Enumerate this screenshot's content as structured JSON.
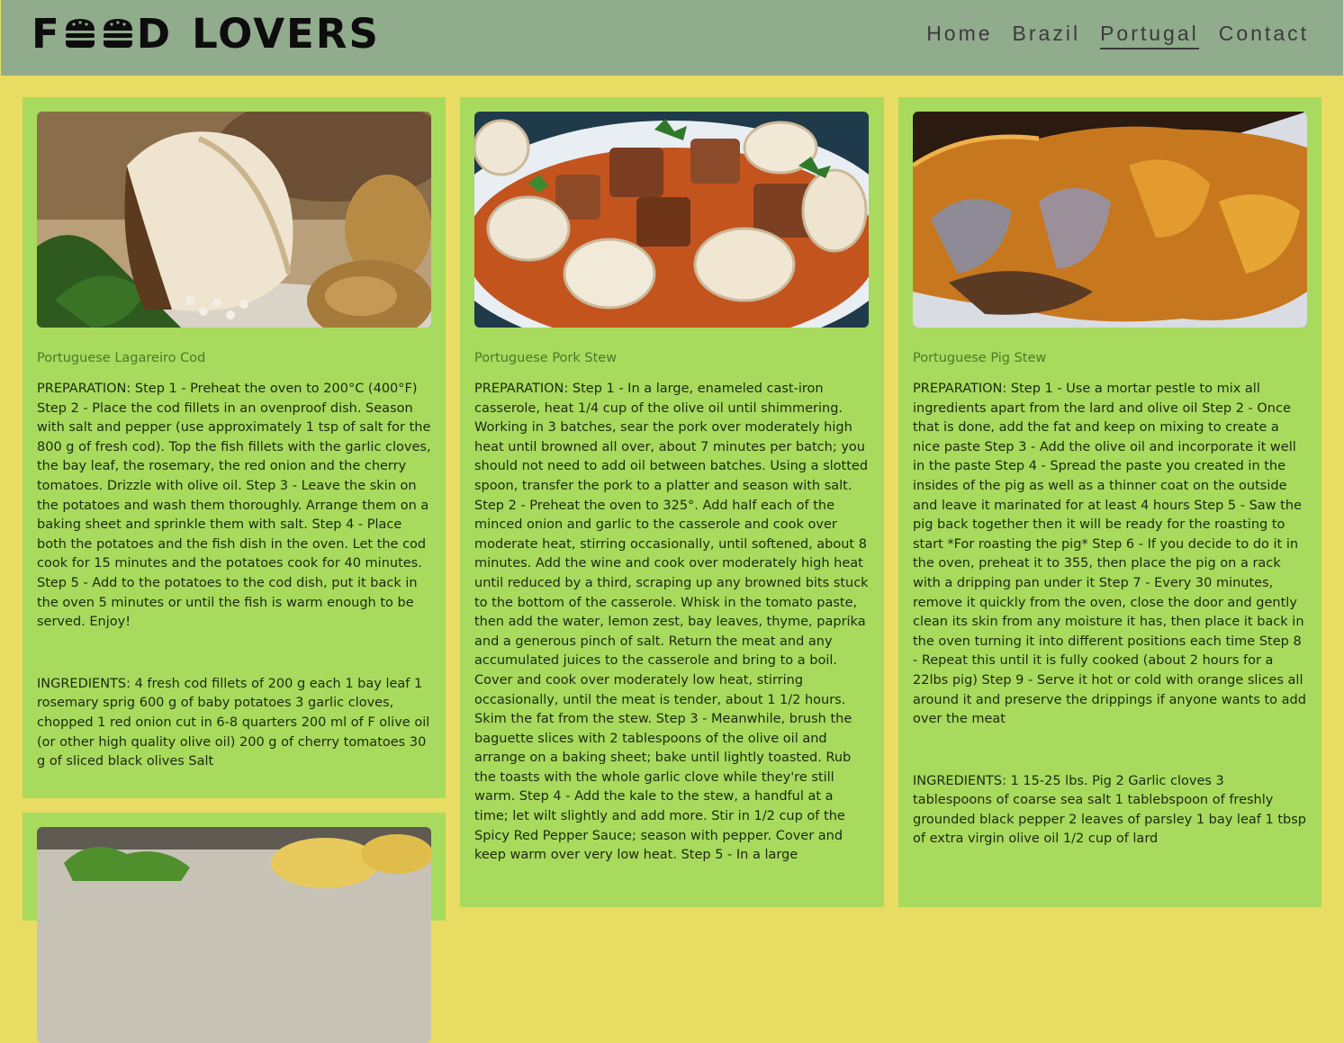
{
  "header": {
    "logo_text": "FOOD LOVERS",
    "logo_letters": {
      "f": "F",
      "d": "D",
      "lovers": "LOVERS"
    },
    "nav": [
      {
        "label": "Home"
      },
      {
        "label": "Brazil"
      },
      {
        "label": "Portugal",
        "active": true
      },
      {
        "label": "Contact"
      }
    ]
  },
  "colors": {
    "page_background": "#e9dc62",
    "header_background": "#91ab8d",
    "card_background": "#a8da5d",
    "title_color": "#4a7a2c"
  },
  "cards": [
    {
      "image": "portuguese-lagareiro-cod-photo",
      "title": "Portuguese Lagareiro Cod",
      "preparation": "PREPARATION: Step 1 - Preheat the oven to 200°C (400°F) Step 2 - Place the cod fillets in an ovenproof dish. Season with salt and pepper (use approximately 1 tsp of salt for the 800 g of fresh cod). Top the fish fillets with the garlic cloves, the bay leaf, the rosemary, the red onion and the cherry tomatoes. Drizzle with olive oil. Step 3 - Leave the skin on the potatoes and wash them thoroughly. Arrange them on a baking sheet and sprinkle them with salt. Step 4 - Place both the potatoes and the fish dish in the oven. Let the cod cook for 15 minutes and the potatoes cook for 40 minutes. Step 5 - Add to the potatoes to the cod dish, put it back in the oven 5 minutes or until the fish is warm enough to be served. Enjoy!",
      "ingredients": "INGREDIENTS: 4 fresh cod fillets of 200 g each 1 bay leaf 1 rosemary sprig 600 g of baby potatoes 3 garlic cloves, chopped 1 red onion cut in 6-8 quarters 200 ml of F olive oil (or other high quality olive oil) 200 g of cherry tomatoes 30 g of sliced black olives Salt"
    },
    {
      "image": "portuguese-pork-stew-photo",
      "title": "Portuguese Pork Stew",
      "preparation": "PREPARATION: Step 1 - In a large, enameled cast-iron casserole, heat 1/4 cup of the olive oil until shimmering. Working in 3 batches, sear the pork over moderately high heat until browned all over, about 7 minutes per batch; you should not need to add oil between batches. Using a slotted spoon, transfer the pork to a platter and season with salt. Step 2 - Preheat the oven to 325°. Add half each of the minced onion and garlic to the casserole and cook over moderate heat, stirring occasionally, until softened, about 8 minutes. Add the wine and cook over moderately high heat until reduced by a third, scraping up any browned bits stuck to the bottom of the casserole. Whisk in the tomato paste, then add the water, lemon zest, bay leaves, thyme, paprika and a generous pinch of salt. Return the meat and any accumulated juices to the casserole and bring to a boil. Cover and cook over moderately low heat, stirring occasionally, until the meat is tender, about 1 1/2 hours. Skim the fat from the stew. Step 3 - Meanwhile, brush the baguette slices with 2 tablespoons of the olive oil and arrange on a baking sheet; bake until lightly toasted. Rub the toasts with the whole garlic clove while they're still warm. Step 4 - Add the kale to the stew, a handful at a time; let wilt slightly and add more. Stir in 1/2 cup of the Spicy Red Pepper Sauce; season with pepper. Cover and keep warm over very low heat. Step 5 - In a large",
      "ingredients": ""
    },
    {
      "image": "portuguese-pig-stew-photo",
      "title": "Portuguese Pig Stew",
      "preparation": "PREPARATION: Step 1 - Use a mortar pestle to mix all ingredients apart from the lard and olive oil Step 2 - Once that is done, add the fat and keep on mixing to create a nice paste Step 3 - Add the olive oil and incorporate it well in the paste Step 4 - Spread the paste you created in the insides of the pig as well as a thinner coat on the outside and leave it marinated for at least 4 hours Step 5 - Saw the pig back together then it will be ready for the roasting to start *For roasting the pig* Step 6 - If you decide to do it in the oven, preheat it to 355, then place the pig on a rack with a dripping pan under it Step 7 - Every 30 minutes, remove it quickly from the oven, close the door and gently clean its skin from any moisture it has, then place it back in the oven turning it into different positions each time Step 8 - Repeat this until it is fully cooked (about 2 hours for a 22lbs pig) Step 9 - Serve it hot or cold with orange slices all around it and preserve the drippings if anyone wants to add over the meat",
      "ingredients": "INGREDIENTS: 1 15-25 lbs. Pig 2 Garlic cloves 3 tablespoons of coarse sea salt 1 tablebspoon of freshly grounded black pepper 2 leaves of parsley 1 bay leaf 1 tbsp of extra virgin olive oil 1/2 cup of lard"
    }
  ],
  "partial_card": {
    "image": "next-dish-photo"
  }
}
